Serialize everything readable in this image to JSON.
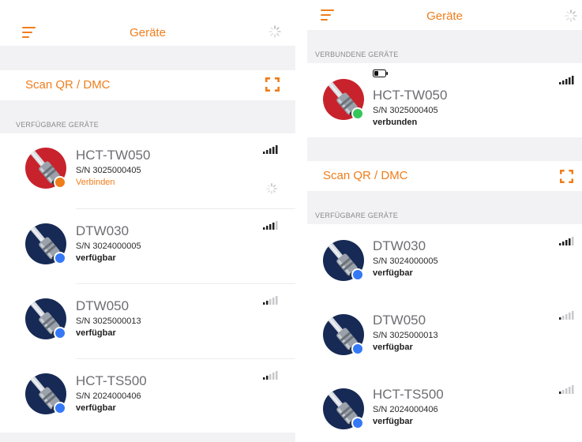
{
  "left": {
    "nav": {
      "title": "Geräte",
      "menu_icon": "hamburger-icon",
      "right_icon": "spinner-icon"
    },
    "scan": {
      "label": "Scan QR / DMC",
      "icon": "qr-scan-icon"
    },
    "available": {
      "header": "VERFÜGBARE GERÄTE",
      "devices": [
        {
          "name": "HCT-TW050",
          "serial": "S/N 3025000405",
          "status": "Verbinden",
          "dot": "#f07d1b",
          "avatar_bg": "#c8232c",
          "signal": 5
        },
        {
          "name": "DTW030",
          "serial": "S/N 3024000005",
          "status": "verfügbar",
          "dot": "#3478f6",
          "avatar_bg": "#172a55",
          "signal": 4
        },
        {
          "name": "DTW050",
          "serial": "S/N 3025000013",
          "status": "verfügbar",
          "dot": "#3478f6",
          "avatar_bg": "#172a55",
          "signal": 2
        },
        {
          "name": "HCT-TS500",
          "serial": "S/N 2024000406",
          "status": "verfügbar",
          "dot": "#3478f6",
          "avatar_bg": "#172a55",
          "signal": 2
        }
      ]
    }
  },
  "right": {
    "nav": {
      "title": "Geräte",
      "menu_icon": "hamburger-icon",
      "right_icon": "spinner-icon"
    },
    "connected": {
      "header": "VERBUNDENE GERÄTE",
      "device": {
        "name": "HCT-TW050",
        "serial": "S/N 3025000405",
        "status": "verbunden",
        "dot": "#35c759",
        "avatar_bg": "#c8232c",
        "signal": 5,
        "battery": 0.4
      }
    },
    "scan": {
      "label": "Scan QR / DMC",
      "icon": "qr-scan-icon"
    },
    "available": {
      "header": "VERFÜGBARE GERÄTE",
      "devices": [
        {
          "name": "DTW030",
          "serial": "S/N 3024000005",
          "status": "verfügbar",
          "dot": "#3478f6",
          "avatar_bg": "#172a55",
          "signal": 4
        },
        {
          "name": "DTW050",
          "serial": "S/N 3025000013",
          "status": "verfügbar",
          "dot": "#3478f6",
          "avatar_bg": "#172a55",
          "signal": 1
        },
        {
          "name": "HCT-TS500",
          "serial": "S/N 2024000406",
          "status": "verfügbar",
          "dot": "#3478f6",
          "avatar_bg": "#172a55",
          "signal": 1
        }
      ]
    }
  },
  "colors": {
    "accent": "#f07d1b",
    "section_bg": "#f2f2f4"
  }
}
